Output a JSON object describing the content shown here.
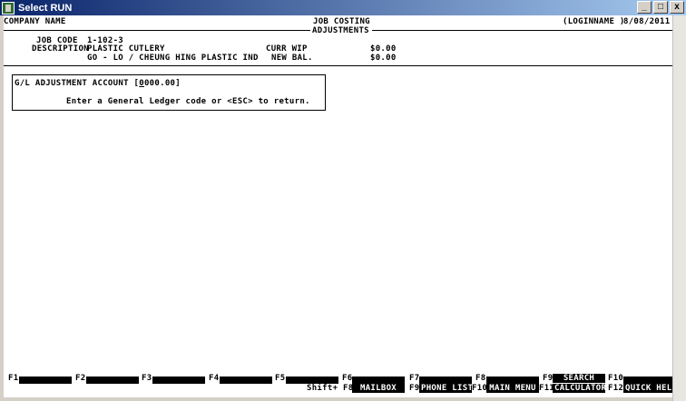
{
  "window": {
    "title": "Select RUN",
    "minimize": "_",
    "maximize": "□",
    "close": "x"
  },
  "header": {
    "company": "COMPANY NAME",
    "module": "JOB COSTING",
    "screen": "ADJUSTMENTS",
    "login": "(LOGINNAME )",
    "date": "8/08/2011"
  },
  "job": {
    "code_label": "JOB CODE",
    "code_value": "1-102-3",
    "desc_label": "DESCRIPTION",
    "desc_line1": "PLASTIC CUTLERY",
    "desc_line2": "GO - LO / CHEUNG HING PLASTIC IND",
    "wip_label": "CURR WIP",
    "wip_value": "$0.00",
    "newbal_label": "NEW BAL.",
    "newbal_value": "$0.00"
  },
  "dialog": {
    "field_label": "G/L ADJUSTMENT ACCOUNT [",
    "field_cursor": "0",
    "field_value": "000.00",
    "field_close": "]",
    "prompt": "Enter a General Ledger code or <ESC> to return."
  },
  "fkeys": {
    "f1": "F1",
    "f2": "F2",
    "f3": "F3",
    "f4": "F4",
    "f5": "F5",
    "f6": "F6",
    "f7": "F7",
    "f8": "F8",
    "f9": "F9",
    "f10": "F10",
    "shift": "Shift+ F8",
    "f9b": "F9",
    "f10b": "F10",
    "f11": "F11",
    "f12": "F12",
    "mailbox": "MAILBOX",
    "phone": "PHONE LIST",
    "menu": "MAIN MENU",
    "search": "SEARCH",
    "calc": "CALCULATOR",
    "help": "QUICK HELP"
  }
}
